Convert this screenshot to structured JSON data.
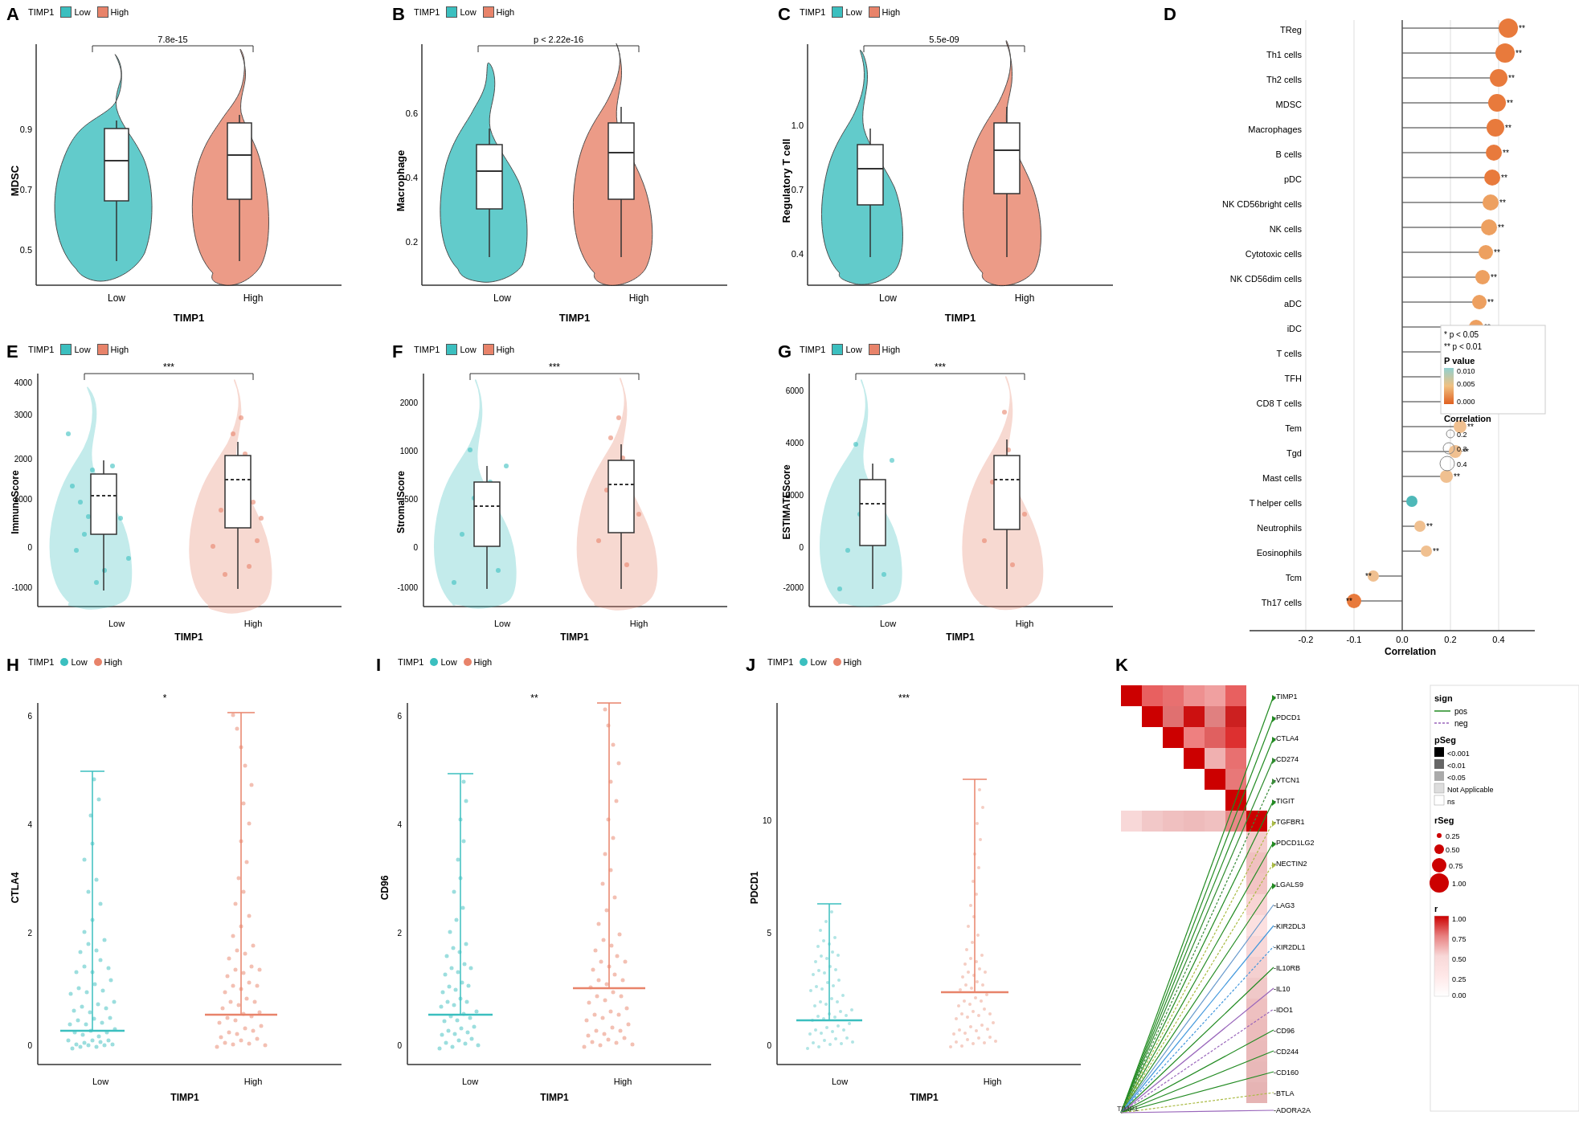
{
  "panels": {
    "A": {
      "label": "A",
      "xLabel": "TIMP1",
      "yLabel": "MDSC",
      "legend": "TIMP1",
      "lowColor": "#3bbfbf",
      "highColor": "#e8836a",
      "pValue": "7.8e-15",
      "xTicks": [
        "Low",
        "High"
      ]
    },
    "B": {
      "label": "B",
      "xLabel": "TIMP1",
      "yLabel": "Macrophage",
      "legend": "TIMP1",
      "lowColor": "#3bbfbf",
      "highColor": "#e8836a",
      "pValue": "p < 2.22e-16",
      "xTicks": [
        "Low",
        "High"
      ]
    },
    "C": {
      "label": "C",
      "xLabel": "TIMP1",
      "yLabel": "Regulatory T cell",
      "legend": "TIMP1",
      "lowColor": "#3bbfbf",
      "highColor": "#e8836a",
      "pValue": "5.5e-09",
      "xTicks": [
        "Low",
        "High"
      ]
    },
    "D": {
      "label": "D",
      "xLabel": "Correlation",
      "yItems": [
        "TReg",
        "Th1 cells",
        "Th2 cells",
        "MDSC",
        "Macrophages",
        "B cells",
        "pDC",
        "NK CD56bright cells",
        "NK cells",
        "Cytotoxic cells",
        "NK CD56dim cells",
        "aDC",
        "iDC",
        "T cells",
        "TFH",
        "CD8 T cells",
        "Tem",
        "Tgd",
        "Mast cells",
        "T helper cells",
        "Neutrophils",
        "Eosinophils",
        "Tcm",
        "Th17 cells"
      ],
      "legendNote1": "* p < 0.05",
      "legendNote2": "** p < 0.01",
      "pValueLabel": "P value",
      "pValues": [
        0.01,
        0.005,
        0.0
      ],
      "correlationLabel": "Correlation",
      "correlationValues": [
        0.2,
        0.3,
        0.4
      ]
    },
    "E": {
      "label": "E",
      "xLabel": "TIMP1",
      "yLabel": "ImmuneScore",
      "legend": "TIMP1",
      "lowColor": "#3bbfbf",
      "highColor": "#e8836a",
      "pValue": "***",
      "xTicks": [
        "Low",
        "High"
      ]
    },
    "F": {
      "label": "F",
      "xLabel": "TIMP1",
      "yLabel": "StromalScore",
      "legend": "TIMP1",
      "lowColor": "#3bbfbf",
      "highColor": "#e8836a",
      "pValue": "***",
      "xTicks": [
        "Low",
        "High"
      ]
    },
    "G": {
      "label": "G",
      "xLabel": "TIMP1",
      "yLabel": "ESTIMATEScore",
      "legend": "TIMP1",
      "lowColor": "#3bbfbf",
      "highColor": "#e8836a",
      "pValue": "***",
      "xTicks": [
        "Low",
        "High"
      ]
    },
    "H": {
      "label": "H",
      "xLabel": "TIMP1",
      "yLabel": "CTLA4",
      "legend": "TIMP1",
      "lowColor": "#3bbfbf",
      "highColor": "#e8836a",
      "pValue": "*",
      "xTicks": [
        "Low",
        "High"
      ]
    },
    "I": {
      "label": "I",
      "xLabel": "TIMP1",
      "yLabel": "CD96",
      "legend": "TIMP1",
      "lowColor": "#3bbfbf",
      "highColor": "#e8836a",
      "pValue": "**",
      "xTicks": [
        "Low",
        "High"
      ]
    },
    "J": {
      "label": "J",
      "xLabel": "TIMP1",
      "yLabel": "PDCD1",
      "legend": "TIMP1",
      "lowColor": "#3bbfbf",
      "highColor": "#e8836a",
      "pValue": "***",
      "xTicks": [
        "Low",
        "High"
      ]
    },
    "K": {
      "label": "K",
      "genes": [
        "TIMP1",
        "PDCD1",
        "CTLA4",
        "CD274",
        "VTCN1",
        "TIGIT",
        "TGFBR1",
        "PDCD1LG2",
        "NECTIN2",
        "LGALS9",
        "LAG3",
        "KIR2DL3",
        "KIR2DL1",
        "IL10RB",
        "IL10",
        "IDO1",
        "CD96",
        "CD244",
        "CD160",
        "BTLA",
        "ADORA2A"
      ]
    }
  }
}
